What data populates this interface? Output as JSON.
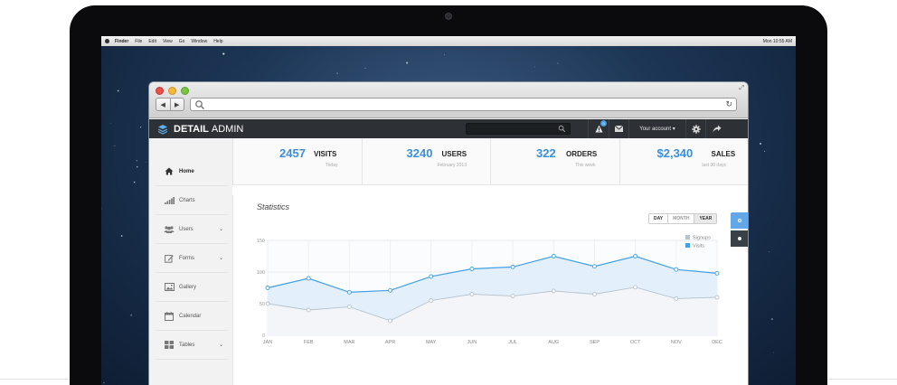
{
  "mac_menu": {
    "items": [
      "Finder",
      "File",
      "Edit",
      "View",
      "Go",
      "Window",
      "Help"
    ],
    "clock": "Mon 10:55 AM"
  },
  "brand": {
    "bold": "DETAIL",
    "light": "ADMIN"
  },
  "topnav": {
    "search_placeholder": "",
    "alert_count": "3",
    "account_label": "Your account ▾"
  },
  "sidebar": {
    "items": [
      {
        "label": "Home",
        "icon": "home-icon",
        "active": true
      },
      {
        "label": "Charts",
        "icon": "bar-chart-icon"
      },
      {
        "label": "Users",
        "icon": "users-icon",
        "has_submenu": true
      },
      {
        "label": "Forms",
        "icon": "edit-icon",
        "has_submenu": true
      },
      {
        "label": "Gallery",
        "icon": "image-icon"
      },
      {
        "label": "Calendar",
        "icon": "calendar-icon"
      },
      {
        "label": "Tables",
        "icon": "grid-icon",
        "has_submenu": true
      }
    ]
  },
  "stats": [
    {
      "value": "2457",
      "label": "VISITS",
      "sub": "Today"
    },
    {
      "value": "3240",
      "label": "USERS",
      "sub": "February 2013"
    },
    {
      "value": "322",
      "label": "ORDERS",
      "sub": "This week"
    },
    {
      "value": "$2,340",
      "label": "SALES",
      "sub": "last 30 days"
    }
  ],
  "panel": {
    "title": "Statistics",
    "range_buttons": [
      {
        "label": "DAY",
        "state": "normal"
      },
      {
        "label": "MONTH",
        "state": "muted"
      },
      {
        "label": "YEAR",
        "state": "selected"
      }
    ]
  },
  "colors": {
    "accent": "#3b8fd9",
    "nav_bg": "#2d3136",
    "visits": "#42a0e8",
    "signups": "#b7c3cf"
  },
  "chart_data": {
    "type": "area",
    "title": "Statistics",
    "categories": [
      "JAN",
      "FEB",
      "MAR",
      "APR",
      "MAY",
      "JUN",
      "JUL",
      "AUG",
      "SEP",
      "OCT",
      "NOV",
      "DEC"
    ],
    "yticks": [
      0,
      50,
      100,
      150
    ],
    "ylim": [
      0,
      150
    ],
    "grid": true,
    "legend": "top-right",
    "series": [
      {
        "name": "Signups",
        "color": "#b7c3cf",
        "values": [
          50,
          40,
          45,
          23,
          55,
          65,
          62,
          70,
          65,
          76,
          58,
          60
        ]
      },
      {
        "name": "Visits",
        "color": "#42a0e8",
        "values": [
          75,
          90,
          68,
          71,
          93,
          105,
          108,
          125,
          109,
          125,
          104,
          98
        ]
      }
    ]
  }
}
